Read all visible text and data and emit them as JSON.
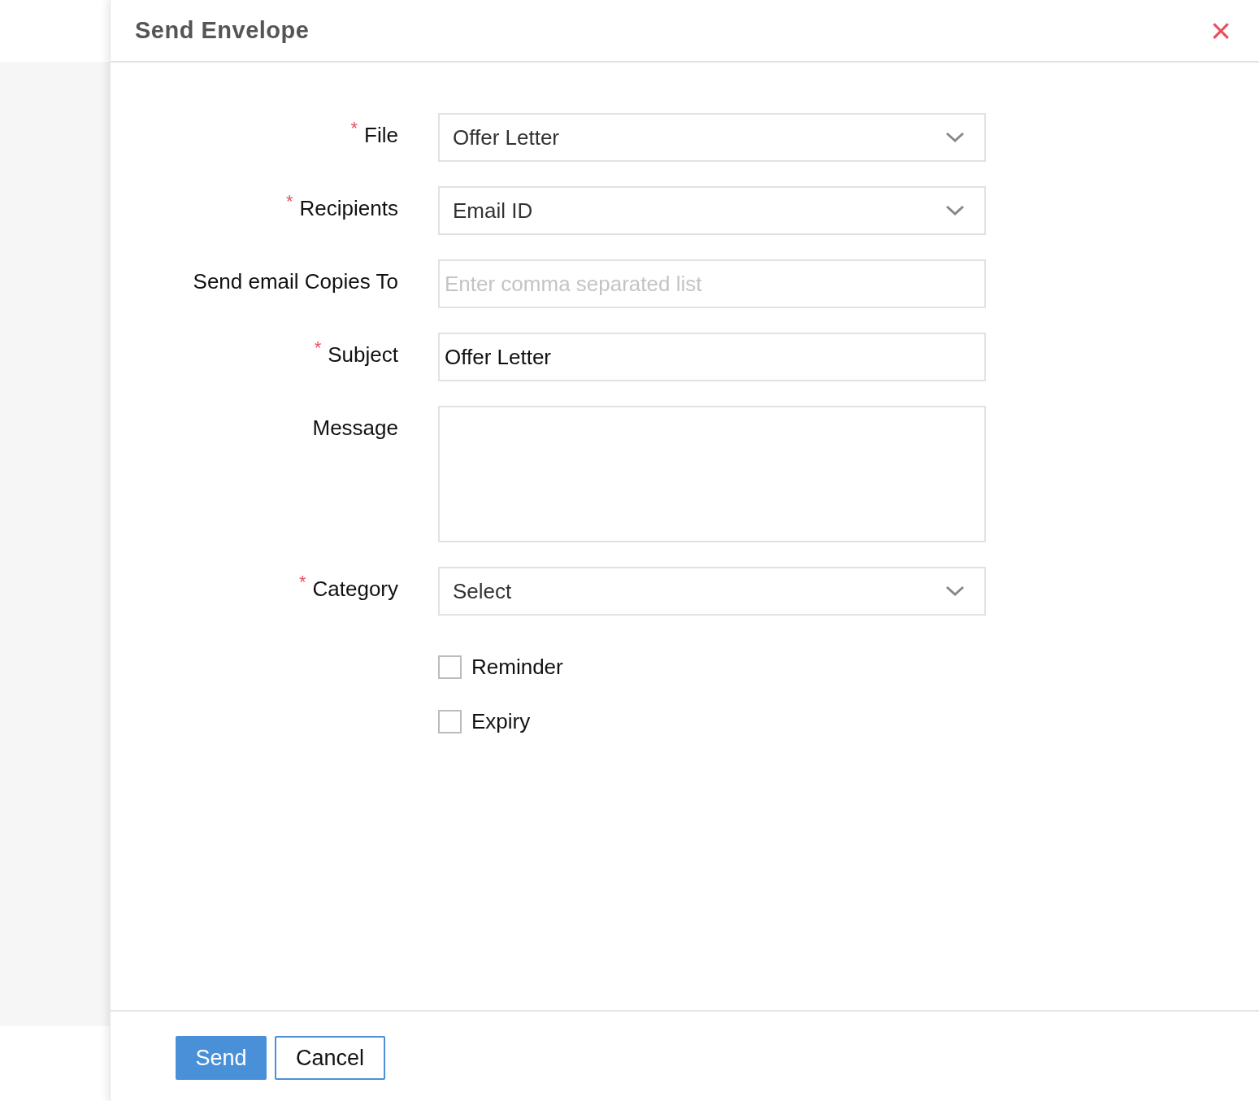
{
  "dialog": {
    "title": "Send Envelope",
    "close": "×"
  },
  "fields": [
    {
      "kind": "select",
      "marker": "*",
      "label": "File",
      "value": "Offer Letter"
    },
    {
      "kind": "select",
      "marker": "*",
      "label": "Recipients",
      "value": "Email ID"
    },
    {
      "kind": "text",
      "label": "Send email Copies To",
      "placeholder": "Enter comma separated list"
    },
    {
      "kind": "text",
      "marker": "*",
      "label": "Subject",
      "value": "Offer Letter"
    },
    {
      "kind": "textarea",
      "label": "Message"
    },
    {
      "kind": "select",
      "marker": "*",
      "label": "Category",
      "value": "Select"
    }
  ],
  "options": [
    {
      "label": "Reminder",
      "checked": false
    },
    {
      "label": "Expiry",
      "checked": false
    }
  ],
  "buttons": [
    {
      "label": "Send",
      "kind": "primary"
    },
    {
      "label": "Cancel",
      "kind": "secondary"
    }
  ]
}
